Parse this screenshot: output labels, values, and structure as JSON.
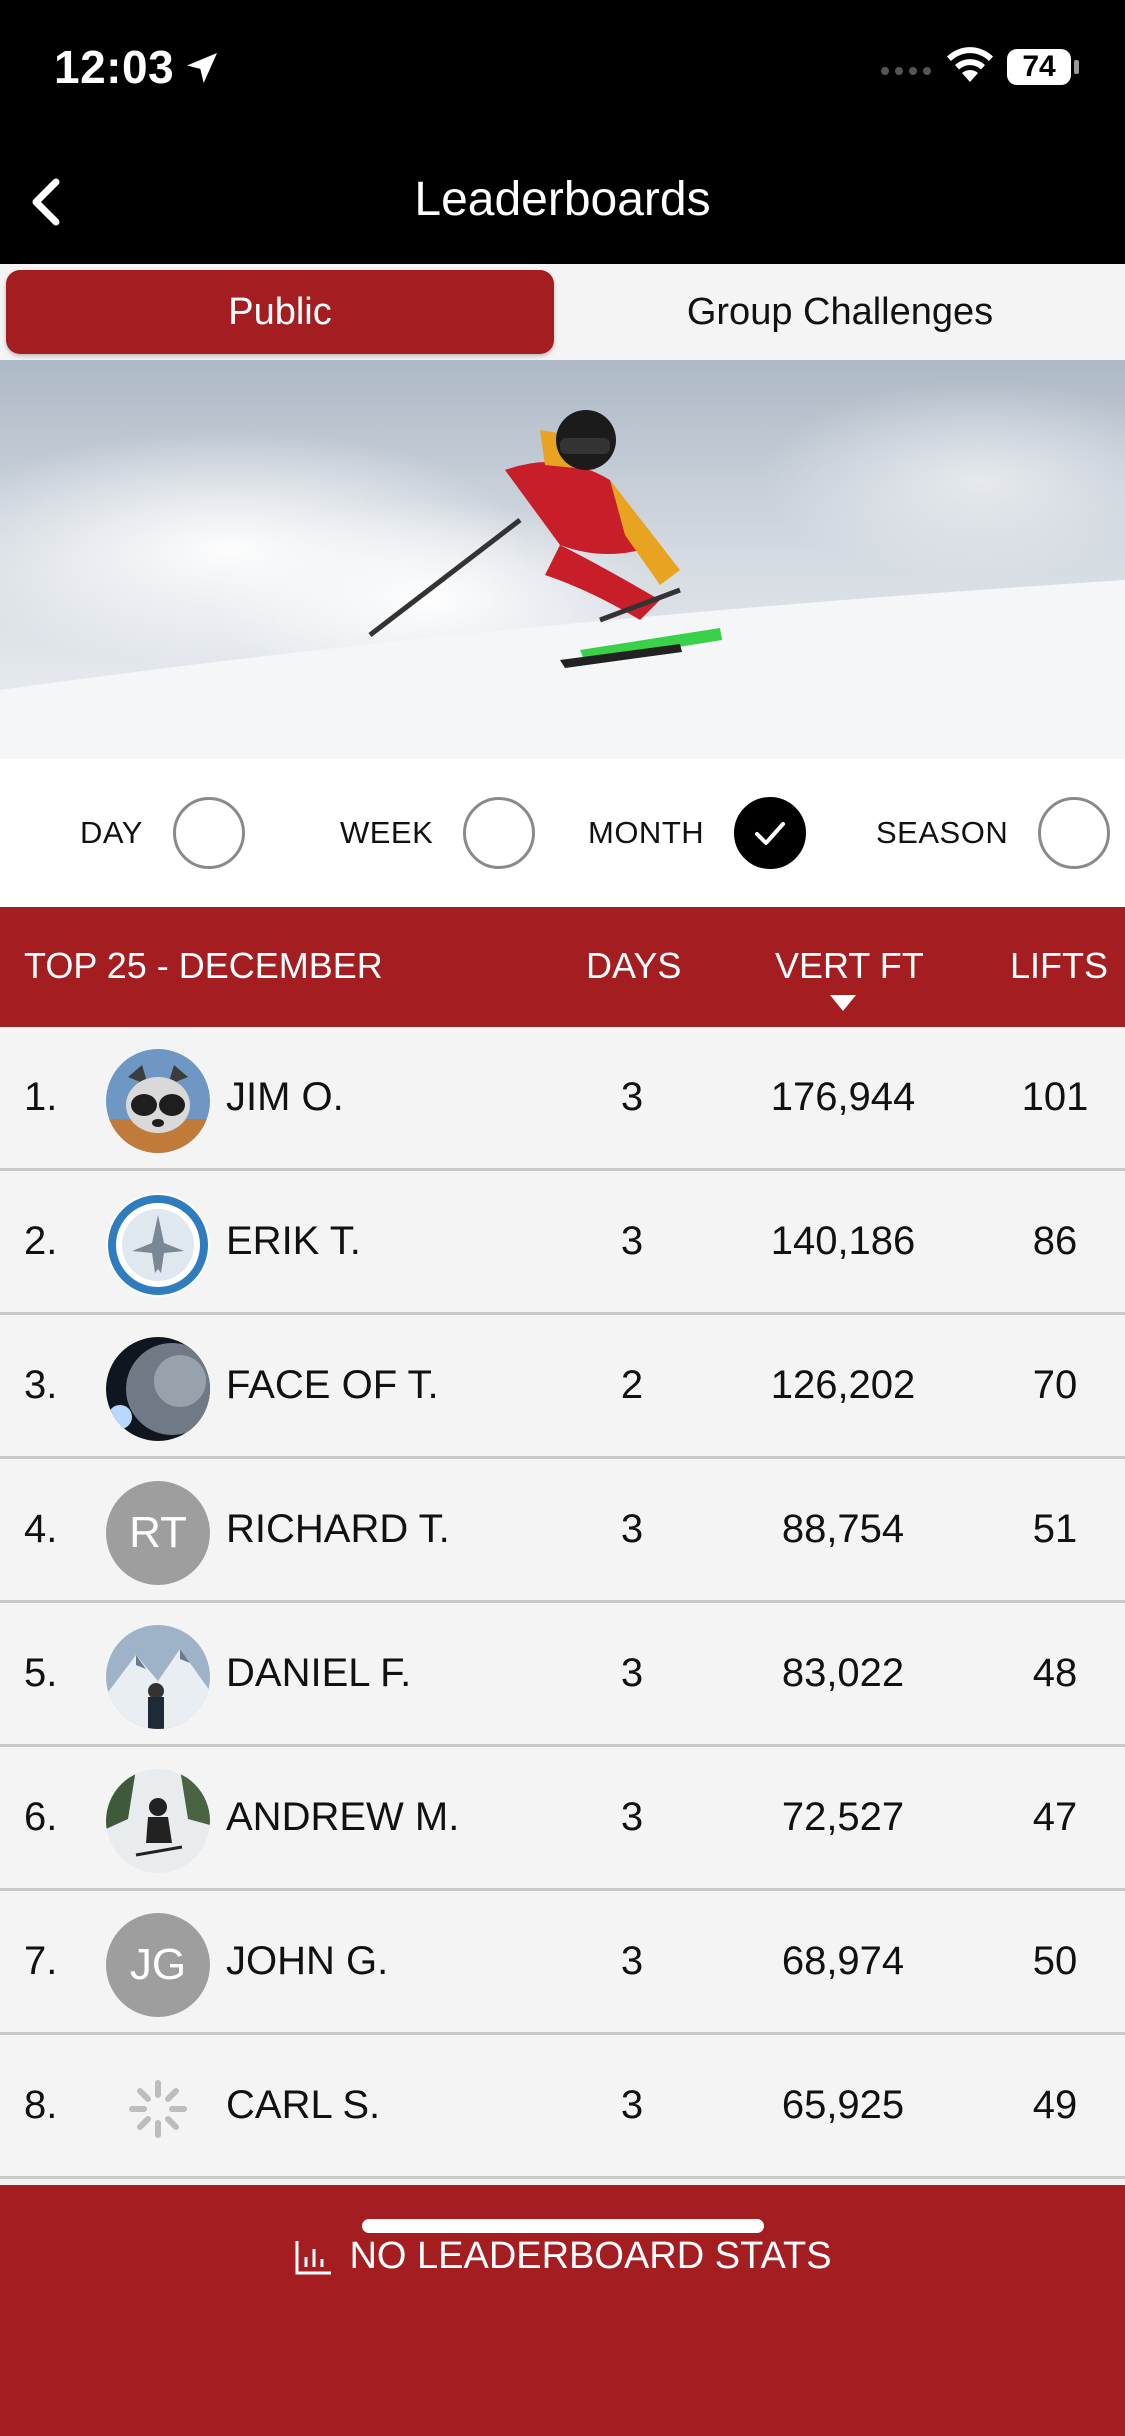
{
  "status_bar": {
    "time": "12:03",
    "battery": "74"
  },
  "nav": {
    "title": "Leaderboards"
  },
  "tabs": [
    {
      "label": "Public",
      "selected": true
    },
    {
      "label": "Group Challenges",
      "selected": false
    }
  ],
  "periods": [
    {
      "label": "DAY",
      "checked": false
    },
    {
      "label": "WEEK",
      "checked": false
    },
    {
      "label": "MONTH",
      "checked": true
    },
    {
      "label": "SEASON",
      "checked": false
    }
  ],
  "table": {
    "title": "TOP 25 - DECEMBER",
    "columns": {
      "days": "DAYS",
      "vert": "VERT FT",
      "lifts": "LIFTS"
    },
    "sort_column": "VERT FT",
    "rows": [
      {
        "rank": "1.",
        "name": "JIM O.",
        "days": "3",
        "vert": "176,944",
        "lifts": "101",
        "avatar": "raccoon-avatar"
      },
      {
        "rank": "2.",
        "name": "ERIK T.",
        "days": "3",
        "vert": "140,186",
        "lifts": "86",
        "avatar": "squadron-badge-avatar"
      },
      {
        "rank": "3.",
        "name": "FACE OF T.",
        "days": "2",
        "vert": "126,202",
        "lifts": "70",
        "avatar": "planet-avatar"
      },
      {
        "rank": "4.",
        "name": "RICHARD T.",
        "days": "3",
        "vert": "88,754",
        "lifts": "51",
        "initials": "RT"
      },
      {
        "rank": "5.",
        "name": "DANIEL F.",
        "days": "3",
        "vert": "83,022",
        "lifts": "48",
        "avatar": "mountain-avatar"
      },
      {
        "rank": "6.",
        "name": "ANDREW M.",
        "days": "3",
        "vert": "72,527",
        "lifts": "47",
        "avatar": "skier-avatar"
      },
      {
        "rank": "7.",
        "name": "JOHN G.",
        "days": "3",
        "vert": "68,974",
        "lifts": "50",
        "initials": "JG"
      },
      {
        "rank": "8.",
        "name": "CARL S.",
        "days": "3",
        "vert": "65,925",
        "lifts": "49",
        "avatar": "loading-spinner-icon"
      }
    ]
  },
  "footer": {
    "label": "NO LEADERBOARD STATS",
    "icon": "bar-chart-icon"
  },
  "colors": {
    "accent": "#a31d21",
    "bar_bg": "#000000",
    "row_bg": "#f4f4f4"
  }
}
